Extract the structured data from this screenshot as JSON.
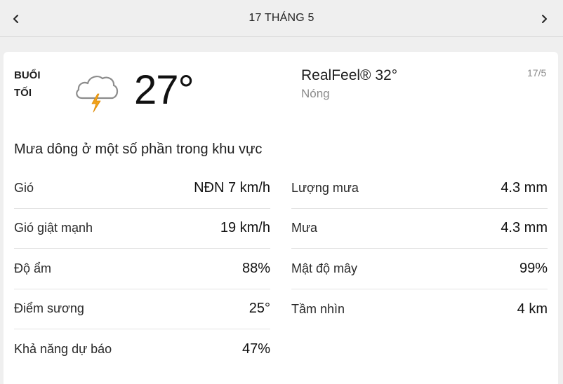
{
  "header": {
    "title": "17 THÁNG 5",
    "prev_icon": "chevron-left-icon",
    "next_icon": "chevron-right-icon"
  },
  "card": {
    "period_line1": "BUỔI",
    "period_line2": "TỐI",
    "icon": "thunderstorm-cloud-icon",
    "temperature": "27°",
    "realfeel": "RealFeel® 32°",
    "realfeel_desc": "Nóng",
    "date": "17/5",
    "phrase": "Mưa dông ở một số phần trong khu vực"
  },
  "left_details": [
    {
      "label": "Gió",
      "value": "NĐN 7 km/h"
    },
    {
      "label": "Gió giật mạnh",
      "value": "19 km/h"
    },
    {
      "label": "Độ ẩm",
      "value": "88%"
    },
    {
      "label": "Điểm sương",
      "value": "25°"
    },
    {
      "label": "Khả năng dự báo",
      "value": "47%"
    }
  ],
  "right_details": [
    {
      "label": "Lượng mưa",
      "value": "4.3 mm"
    },
    {
      "label": "Mưa",
      "value": "4.3 mm"
    },
    {
      "label": "Mật độ mây",
      "value": "99%"
    },
    {
      "label": "Tầm nhìn",
      "value": "4 km"
    }
  ],
  "colors": {
    "background": "#efefef",
    "card": "#ffffff",
    "lightning": "#f0a21a",
    "cloud_stroke": "#8c8c8c",
    "muted_text": "#8a8a8a"
  }
}
